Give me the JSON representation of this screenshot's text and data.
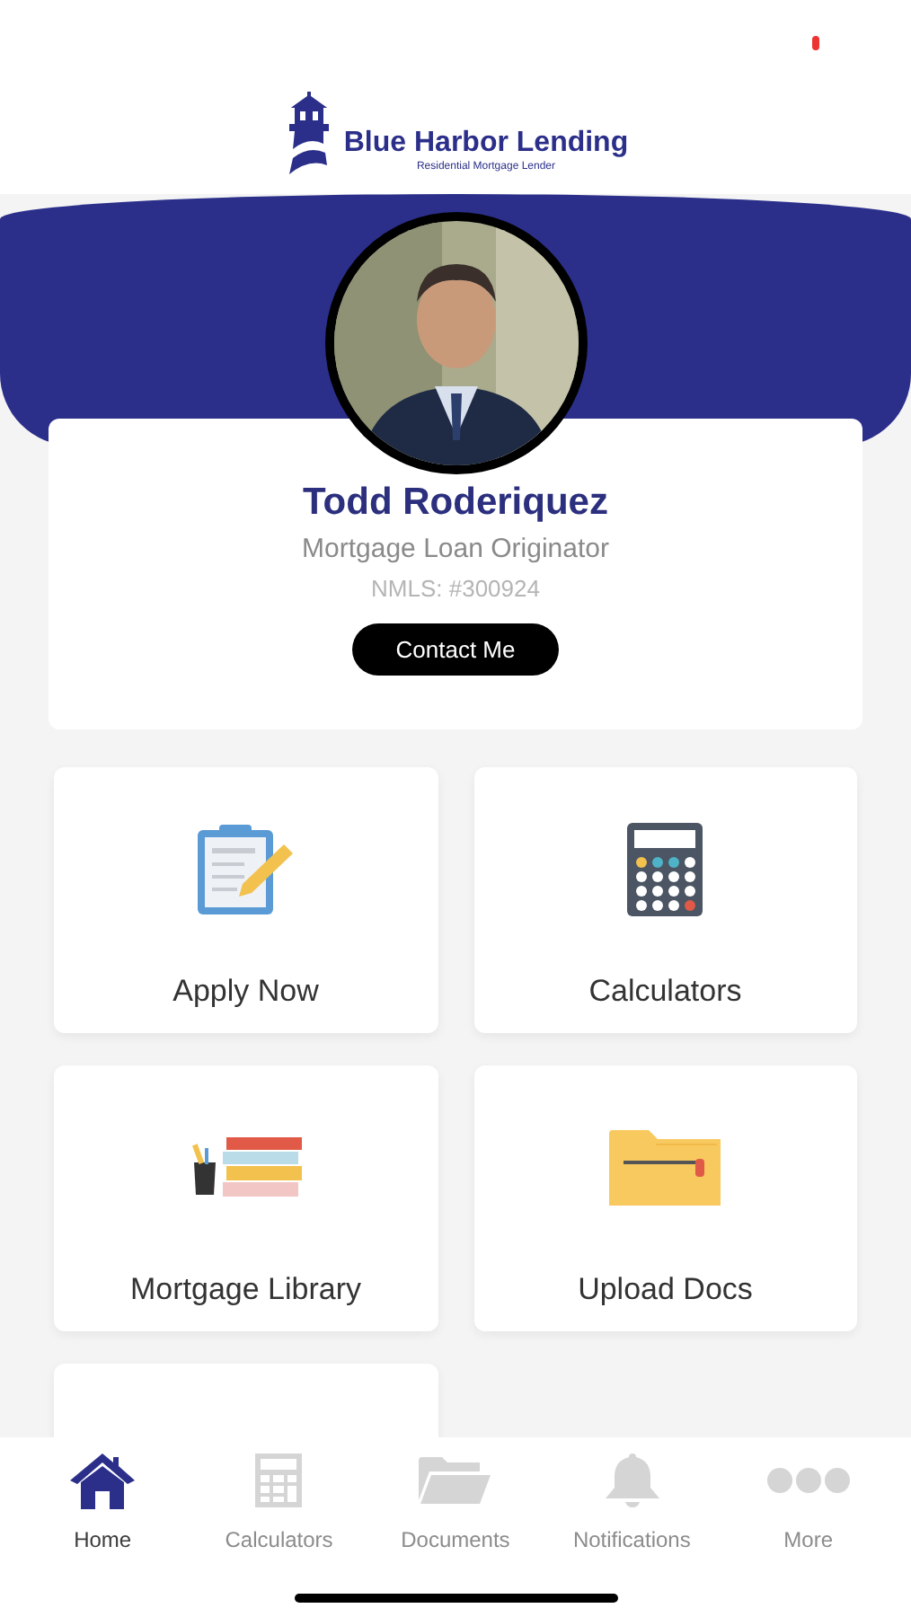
{
  "brand": {
    "name": "Blue Harbor Lending",
    "tagline": "Residential Mortgage Lender"
  },
  "profile": {
    "name": "Todd Roderiquez",
    "title": "Mortgage Loan Originator",
    "nmls": "NMLS: #300924",
    "contact_button": "Contact Me"
  },
  "tiles": [
    {
      "kind": "clipboard",
      "label": "Apply Now"
    },
    {
      "kind": "calculator",
      "label": "Calculators"
    },
    {
      "kind": "books",
      "label": "Mortgage Library"
    },
    {
      "kind": "folder",
      "label": "Upload Docs"
    },
    {
      "kind": "partial"
    }
  ],
  "nav": [
    {
      "kind": "home",
      "label": "Home",
      "selected": true
    },
    {
      "kind": "calculator",
      "label": "Calculators",
      "selected": false
    },
    {
      "kind": "folder",
      "label": "Documents",
      "selected": false
    },
    {
      "kind": "bell",
      "label": "Notifications",
      "selected": false
    },
    {
      "kind": "more",
      "label": "More",
      "selected": false
    }
  ]
}
